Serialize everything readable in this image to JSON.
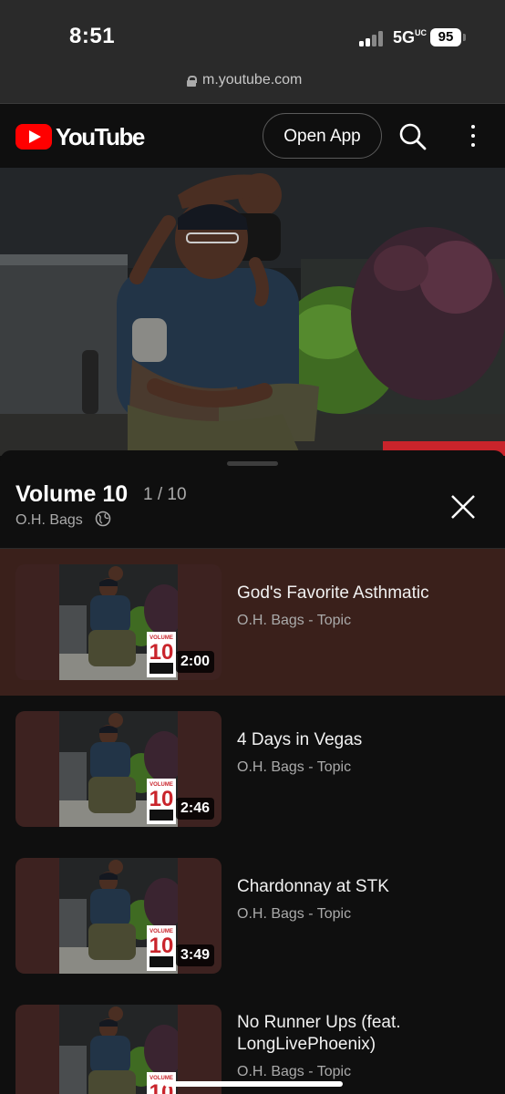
{
  "status_bar": {
    "time": "8:51",
    "network": "5G",
    "network_suffix": "UC",
    "battery": "95"
  },
  "browser": {
    "url": "m.youtube.com"
  },
  "header": {
    "logo_text": "YouTube",
    "open_app_label": "Open App",
    "search_icon": "search-icon",
    "more_icon": "more-vert-icon",
    "brand_color": "#ff0000"
  },
  "playlist": {
    "title": "Volume 10",
    "position": "1 / 10",
    "author": "O.H. Bags",
    "privacy_icon": "globe-icon",
    "close_icon": "close-icon",
    "active_color": "#3a201b",
    "items": [
      {
        "title": "God's Favorite Asthmatic",
        "channel": "O.H. Bags - Topic",
        "duration": "2:00",
        "active": true
      },
      {
        "title": "4 Days in Vegas",
        "channel": "O.H. Bags - Topic",
        "duration": "2:46",
        "active": false
      },
      {
        "title": "Chardonnay at STK",
        "channel": "O.H. Bags - Topic",
        "duration": "3:49",
        "active": false
      },
      {
        "title": "No Runner Ups (feat. LongLivePhoenix)",
        "channel": "O.H. Bags - Topic",
        "duration": "",
        "active": false
      }
    ]
  }
}
